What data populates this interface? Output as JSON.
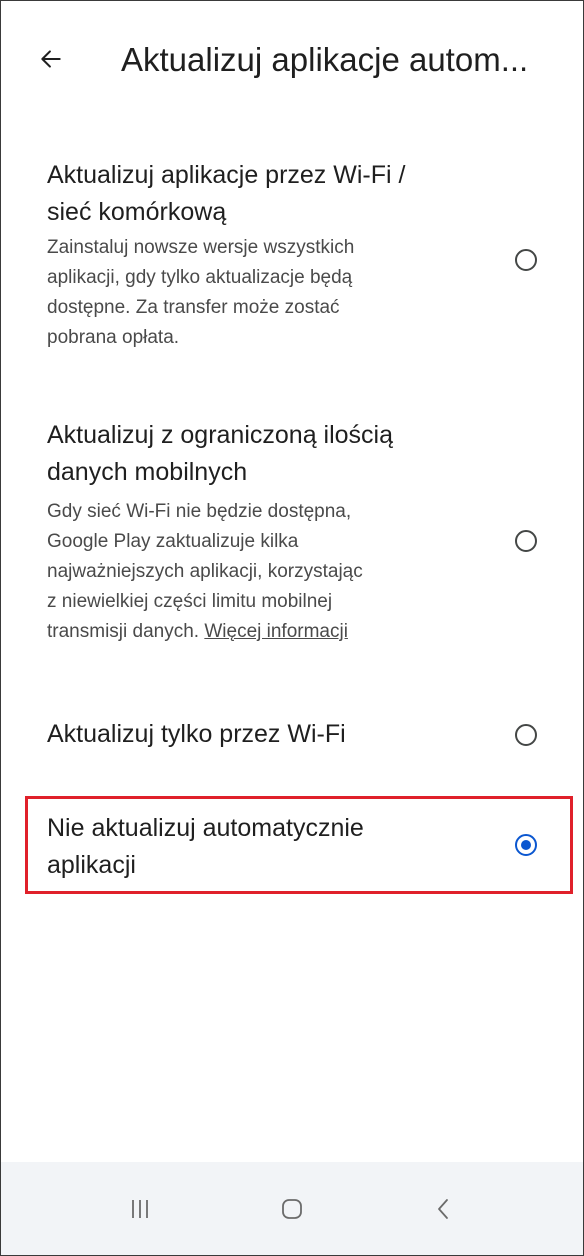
{
  "header": {
    "title": "Aktualizuj aplikacje autom...",
    "back_icon": "arrow-left-icon"
  },
  "options": [
    {
      "title_lines": [
        "Aktualizuj aplikacje przez Wi-Fi /",
        "sieć komórkową"
      ],
      "desc_lines": [
        "Zainstaluj nowsze wersje wszystkich",
        "aplikacji, gdy tylko aktualizacje będą",
        "dostępne. Za transfer może zostać",
        "pobrana opłata."
      ],
      "selected": false
    },
    {
      "title_lines": [
        "Aktualizuj z ograniczoną ilością",
        "danych mobilnych"
      ],
      "desc_lines": [
        "Gdy sieć Wi-Fi nie będzie dostępna,",
        "Google Play zaktualizuje kilka",
        "najważniejszych aplikacji, korzystając",
        "z niewielkiej części limitu mobilnej",
        "transmisji danych."
      ],
      "link": "Więcej informacji",
      "selected": false
    },
    {
      "title_lines": [
        "Aktualizuj tylko przez Wi-Fi"
      ],
      "selected": false
    },
    {
      "title_lines": [
        "Nie aktualizuj automatycznie",
        "aplikacji"
      ],
      "selected": true
    }
  ],
  "colors": {
    "accent": "#0b57d0",
    "highlight": "#e0202a",
    "navbar": "#f2f4f7"
  },
  "navbar": {
    "icons": [
      "recent-apps-icon",
      "home-icon",
      "back-chevron-icon"
    ]
  }
}
